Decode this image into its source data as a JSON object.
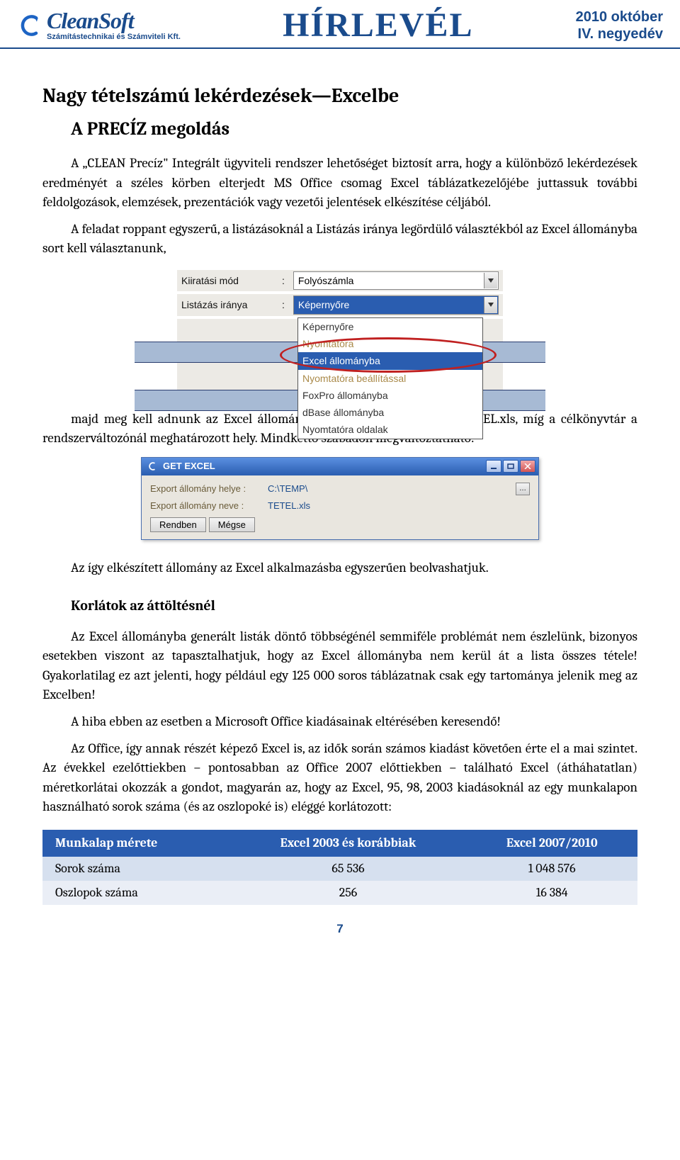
{
  "header": {
    "logo_name": "CleanSoft",
    "logo_sub": "Számítástechnikai és Számviteli Kft.",
    "center_title": "HÍRLEVÉL",
    "date_line1": "2010 október",
    "date_line2": "IV. negyedév"
  },
  "doc": {
    "h1": "Nagy tételszámú lekérdezések—Excelbe",
    "h2": "A PRECÍZ megoldás",
    "p1": "A „CLEAN Precíz\" Integrált ügyviteli rendszer lehetőséget biztosít arra, hogy a különböző lekérdezések eredményét a széles körben elterjedt MS Office csomag Excel táblázatkezelőjébe juttassuk további feldolgozások, elemzések, prezentációk vagy vezetői jelentések elkészítése céljából.",
    "p2": "A feladat roppant egyszerű, a listázásoknál a Listázás iránya legördülő választékból az Excel állományba sort kell választanunk,",
    "p3": "majd meg kell adnunk az Excel állomány nevét, ami alapesetben a TETEL.xls, míg a célkönyvtár a rendszerváltozónál meghatározott hely. Mindkettő szabadon megváltoztatható!",
    "p4": "Az így elkészített állomány az Excel alkalmazásba egyszerűen beolvashatjuk.",
    "sub_bold": "Korlátok az áttöltésnél",
    "p5": "Az Excel állományba generált listák döntő többségénél semmiféle problémát nem észlelünk, bizonyos esetekben viszont az tapasztalhatjuk, hogy az Excel állományba nem kerül át a lista összes tétele! Gyakorlatilag ez azt jelenti, hogy például egy 125 000 soros táblázatnak csak egy tartománya jelenik meg az Excelben!",
    "p6": "A hiba ebben az esetben a Microsoft Office kiadásainak eltérésében keresendő!",
    "p7": "Az Office, így annak részét képező Excel is, az idők során számos kiadást követően érte el a mai szintet. Az évekkel ezelőttiekben – pontosabban az Office 2007 előttiekben – található Excel (átháhatatlan) méretkorlátai okozzák a gondot, magyarán az, hogy az Excel, 95, 98, 2003 kiadásoknál az egy munkalapon használható sorok száma (és az oszlopoké is) eléggé korlátozott:"
  },
  "ss1": {
    "label1": "Kiiratási mód",
    "value1": "Folyószámla",
    "label2": "Listázás iránya",
    "value2": "Képernyőre",
    "options": [
      "Képernyőre",
      "Nyomtatóra",
      "Excel állományba",
      "Nyomtatóra beállítással",
      "FoxPro állományba",
      "dBase állományba",
      "Nyomtatóra oldalak"
    ],
    "highlight_index": 2
  },
  "ss2": {
    "title": "GET EXCEL",
    "label1": "Export állomány helye :",
    "value1": "C:\\TEMP\\",
    "label2": "Export állomány neve  :",
    "value2": "TETEL.xls",
    "btn_ok": "Rendben",
    "btn_cancel": "Mégse",
    "browse": "…"
  },
  "table": {
    "headers": [
      "Munkalap mérete",
      "Excel 2003 és korábbiak",
      "Excel 2007/2010"
    ],
    "rows": [
      {
        "label": "Sorok száma",
        "v1": "65 536",
        "v2": "1 048 576"
      },
      {
        "label": "Oszlopok száma",
        "v1": "256",
        "v2": "16 384"
      }
    ]
  },
  "pagenum": "7"
}
